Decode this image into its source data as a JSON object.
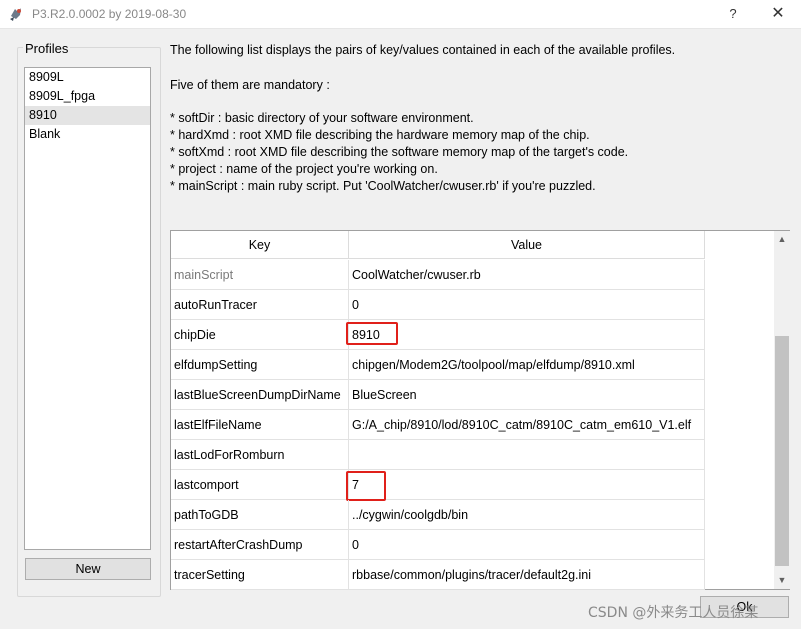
{
  "window": {
    "title": "P3.R2.0.0002 by 2019-08-30",
    "help_label": "?",
    "close_label": "✕",
    "app_icon": "app-icon"
  },
  "profiles": {
    "label": "Profiles",
    "items": [
      "8909L",
      "8909L_fpga",
      "8910",
      "Blank"
    ],
    "selected": "8910",
    "new_label": "New"
  },
  "description": {
    "intro": "The following list displays the pairs of key/values contained in each of the available profiles.",
    "mandatory": "Five of them are mandatory :",
    "bullets": [
      "* softDir : basic directory of your software environment.",
      "* hardXmd : root XMD file describing the hardware memory map of the chip.",
      "* softXmd : root XMD file describing the software memory map of the target's code.",
      "* project : name of the project you're working on.",
      "* mainScript : main ruby script. Put 'CoolWatcher/cwuser.rb' if you're puzzled."
    ]
  },
  "table": {
    "headers": {
      "key": "Key",
      "value": "Value"
    },
    "rows": [
      {
        "key": "mainScript",
        "value": "CoolWatcher/cwuser.rb"
      },
      {
        "key": "autoRunTracer",
        "value": "0"
      },
      {
        "key": "chipDie",
        "value": "8910"
      },
      {
        "key": "elfdumpSetting",
        "value": "chipgen/Modem2G/toolpool/map/elfdump/8910.xml"
      },
      {
        "key": "lastBlueScreenDumpDirName",
        "value": "BlueScreen"
      },
      {
        "key": "lastElfFileName",
        "value": "G:/A_chip/8910/lod/8910C_catm/8910C_catm_em610_V1.elf"
      },
      {
        "key": "lastLodForRomburn",
        "value": ""
      },
      {
        "key": "lastcomport",
        "value": "7"
      },
      {
        "key": "pathToGDB",
        "value": "../cygwin/coolgdb/bin"
      },
      {
        "key": "restartAfterCrashDump",
        "value": "0"
      },
      {
        "key": "tracerSetting",
        "value": "rbbase/common/plugins/tracer/default2g.ini"
      }
    ]
  },
  "ok_label": "Ok",
  "watermark": "CSDN @外来务工人员徐某",
  "colors": {
    "highlight": "#e0201a",
    "selection": "#e4e4e4"
  }
}
